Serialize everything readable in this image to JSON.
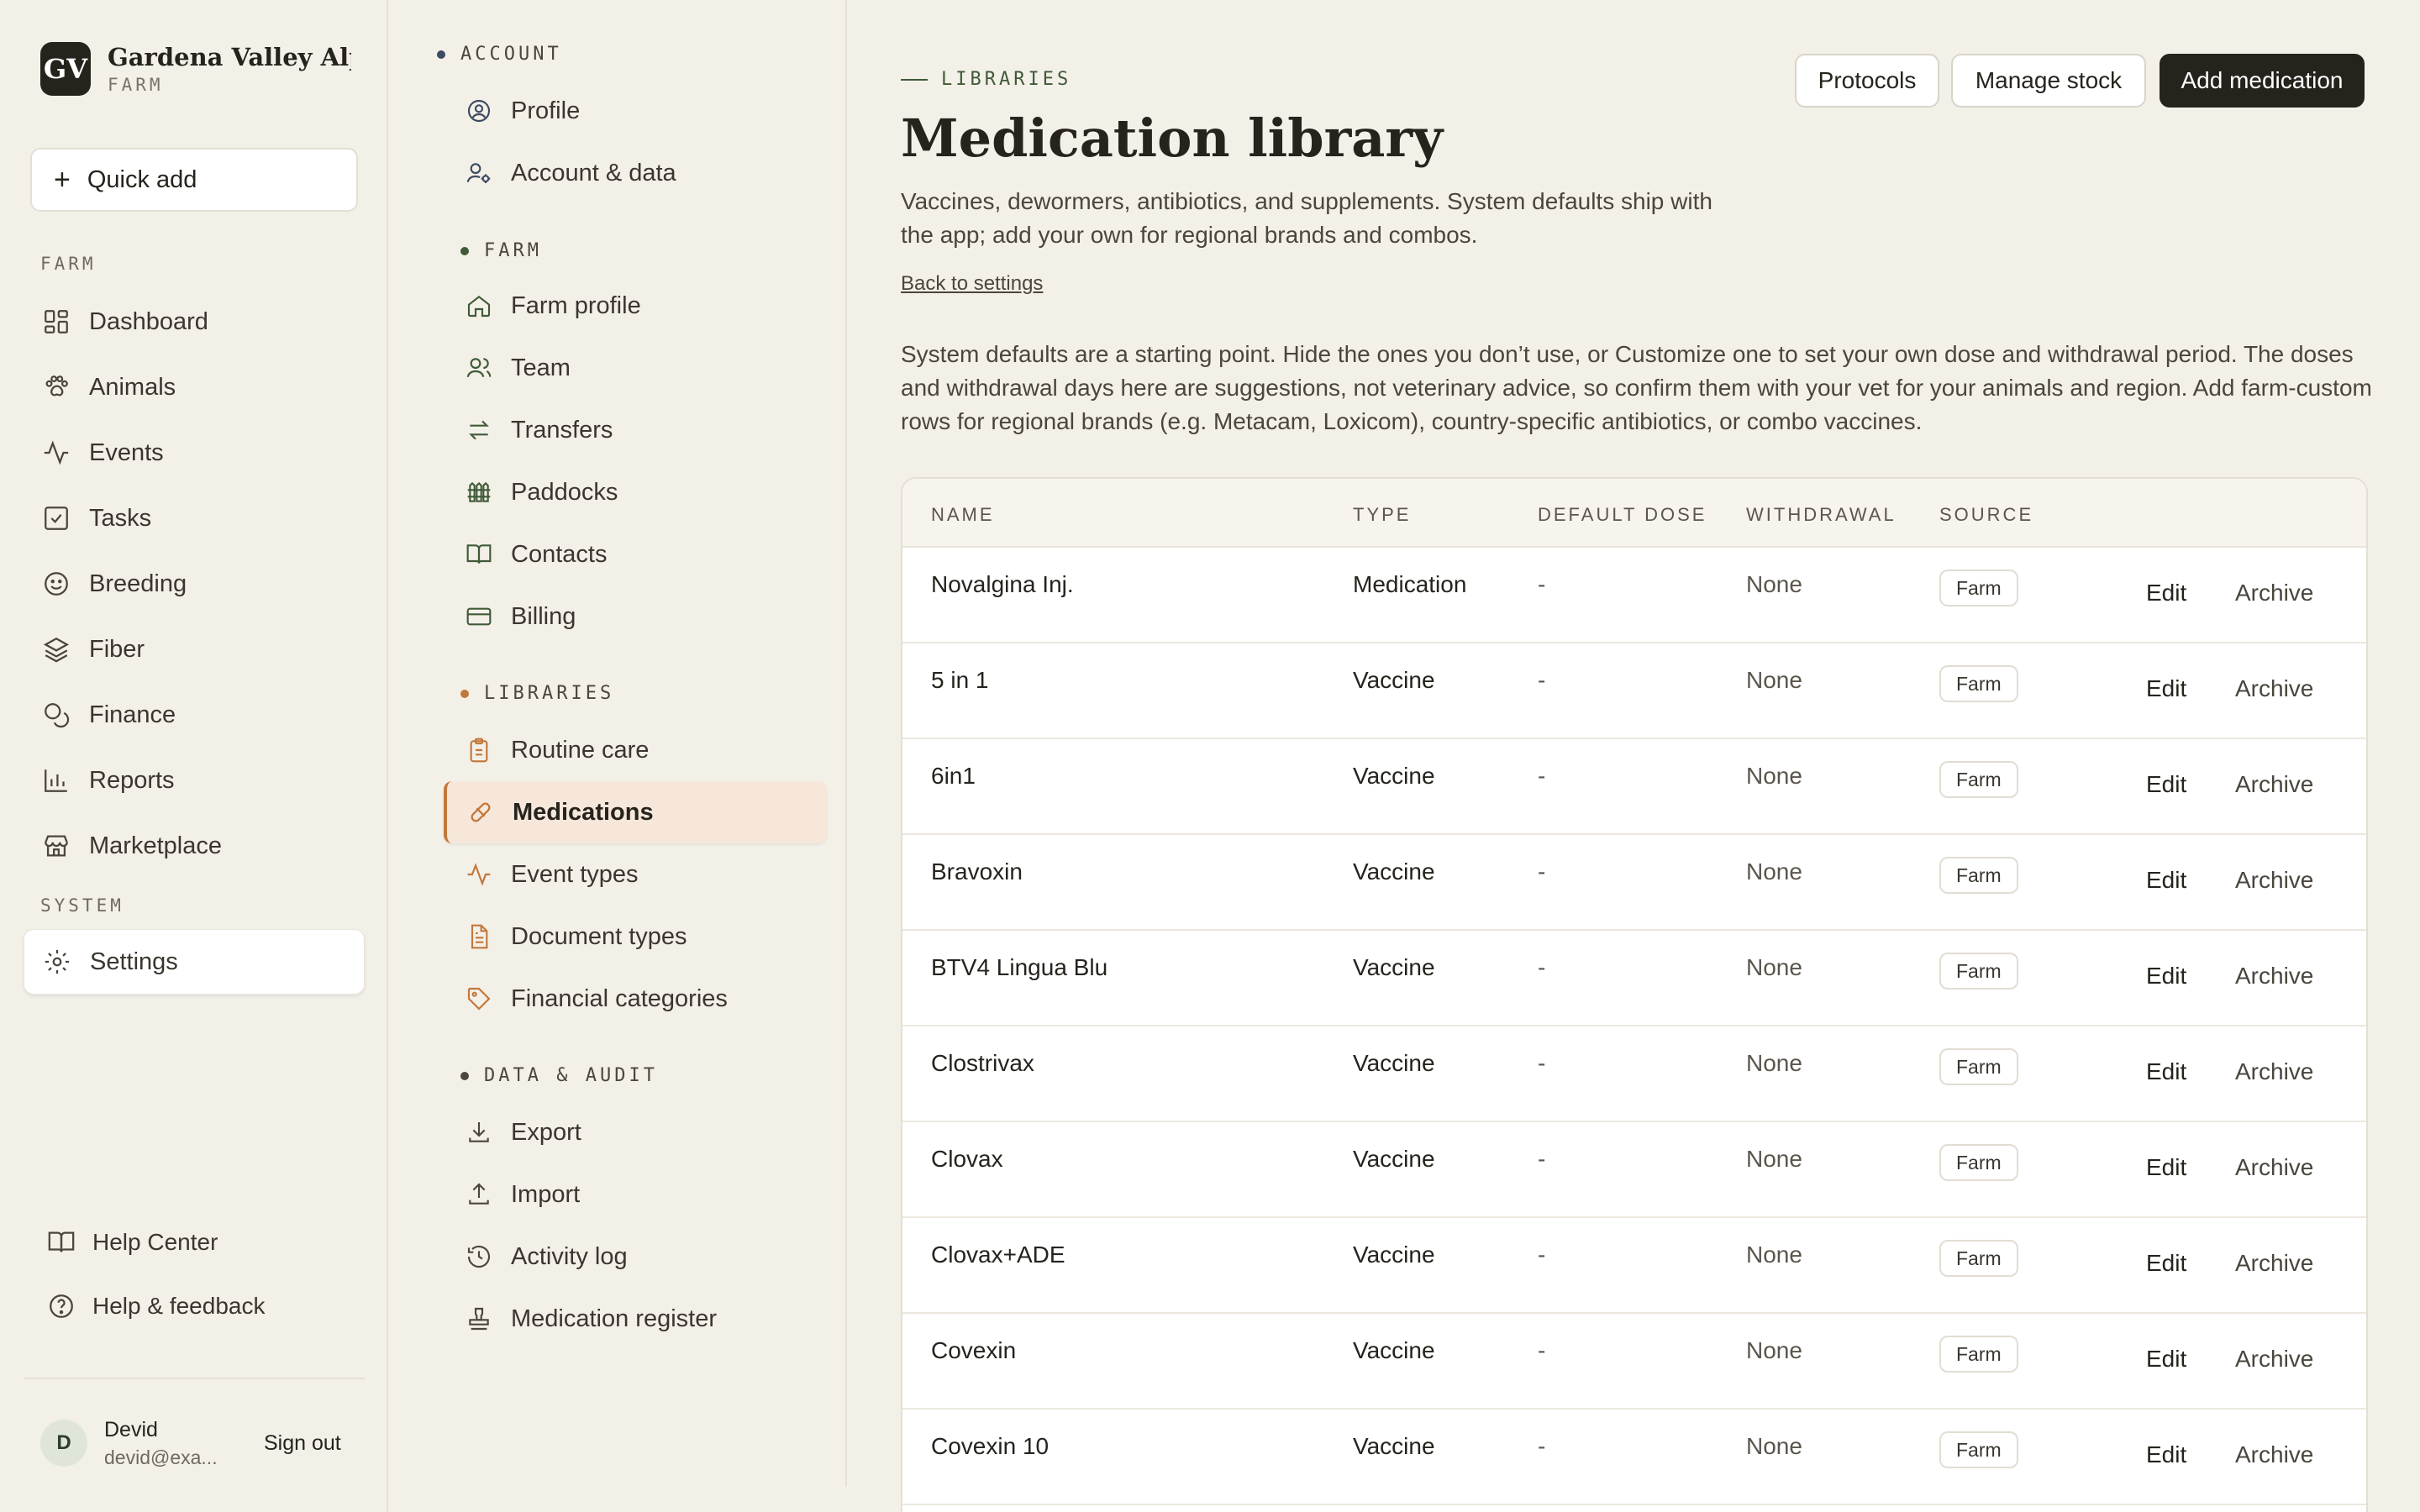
{
  "brand": {
    "initials": "GV",
    "name": "Gardena Valley Alp...",
    "subtitle": "FARM"
  },
  "quick_add": {
    "label": "Quick add"
  },
  "nav": {
    "farm_label": "FARM",
    "system_label": "SYSTEM",
    "items": [
      {
        "label": "Dashboard",
        "icon": "grid-icon"
      },
      {
        "label": "Animals",
        "icon": "paw-icon"
      },
      {
        "label": "Events",
        "icon": "activity-icon"
      },
      {
        "label": "Tasks",
        "icon": "checkbox-icon"
      },
      {
        "label": "Breeding",
        "icon": "smile-icon"
      },
      {
        "label": "Fiber",
        "icon": "layers-icon"
      },
      {
        "label": "Finance",
        "icon": "coins-icon"
      },
      {
        "label": "Reports",
        "icon": "bar-chart-icon"
      },
      {
        "label": "Marketplace",
        "icon": "store-icon"
      }
    ],
    "settings_label": "Settings"
  },
  "help": {
    "help_center": "Help Center",
    "feedback": "Help & feedback"
  },
  "user": {
    "initial": "D",
    "name": "Devid",
    "email": "devid@exa...",
    "sign_out": "Sign out"
  },
  "settings_nav": {
    "account_label": "ACCOUNT",
    "farm_label": "FARM",
    "libraries_label": "LIBRARIES",
    "data_label": "DATA & AUDIT",
    "account_items": [
      "Profile",
      "Account & data"
    ],
    "farm_items": [
      "Farm profile",
      "Team",
      "Transfers",
      "Paddocks",
      "Contacts",
      "Billing"
    ],
    "library_items": [
      "Routine care",
      "Medications",
      "Event types",
      "Document types",
      "Financial categories"
    ],
    "data_items": [
      "Export",
      "Import",
      "Activity log",
      "Medication register"
    ]
  },
  "main": {
    "eyebrow": "LIBRARIES",
    "title": "Medication library",
    "description": "Vaccines, dewormers, antibiotics, and supplements. System defaults ship with the app; add your own for regional brands and combos.",
    "back_link": "Back to settings",
    "info": "System defaults are a starting point. Hide the ones you don’t use, or Customize one to set your own dose and withdrawal period. The doses and withdrawal days here are suggestions, not veterinary advice, so confirm them with your vet for your animals and region. Add farm-custom rows for regional brands (e.g. Metacam, Loxicom), country-specific antibiotics, or combo vaccines.",
    "buttons": {
      "protocols": "Protocols",
      "manage_stock": "Manage stock",
      "add_medication": "Add medication"
    }
  },
  "table": {
    "headers": {
      "name": "NAME",
      "type": "TYPE",
      "dose": "DEFAULT DOSE",
      "withdrawal": "WITHDRAWAL",
      "source": "SOURCE"
    },
    "edit_label": "Edit",
    "archive_label": "Archive",
    "rows": [
      {
        "name": "Novalgina Inj.",
        "type": "Medication",
        "dose": "-",
        "withdrawal": "None",
        "source": "Farm"
      },
      {
        "name": "5 in 1",
        "type": "Vaccine",
        "dose": "-",
        "withdrawal": "None",
        "source": "Farm"
      },
      {
        "name": "6in1",
        "type": "Vaccine",
        "dose": "-",
        "withdrawal": "None",
        "source": "Farm"
      },
      {
        "name": "Bravoxin",
        "type": "Vaccine",
        "dose": "-",
        "withdrawal": "None",
        "source": "Farm"
      },
      {
        "name": "BTV4 Lingua Blu",
        "type": "Vaccine",
        "dose": "-",
        "withdrawal": "None",
        "source": "Farm"
      },
      {
        "name": "Clostrivax",
        "type": "Vaccine",
        "dose": "-",
        "withdrawal": "None",
        "source": "Farm"
      },
      {
        "name": "Clovax",
        "type": "Vaccine",
        "dose": "-",
        "withdrawal": "None",
        "source": "Farm"
      },
      {
        "name": "Clovax+ADE",
        "type": "Vaccine",
        "dose": "-",
        "withdrawal": "None",
        "source": "Farm"
      },
      {
        "name": "Covexin",
        "type": "Vaccine",
        "dose": "-",
        "withdrawal": "None",
        "source": "Farm"
      },
      {
        "name": "Covexin 10",
        "type": "Vaccine",
        "dose": "-",
        "withdrawal": "None",
        "source": "Farm"
      }
    ]
  },
  "colors": {
    "accent_dark": "#26231d",
    "libraries_dot": "#c3773b",
    "farm_dot": "#3f5a37",
    "account_dot": "#3d4a63",
    "active_bg": "#f6e7da"
  }
}
